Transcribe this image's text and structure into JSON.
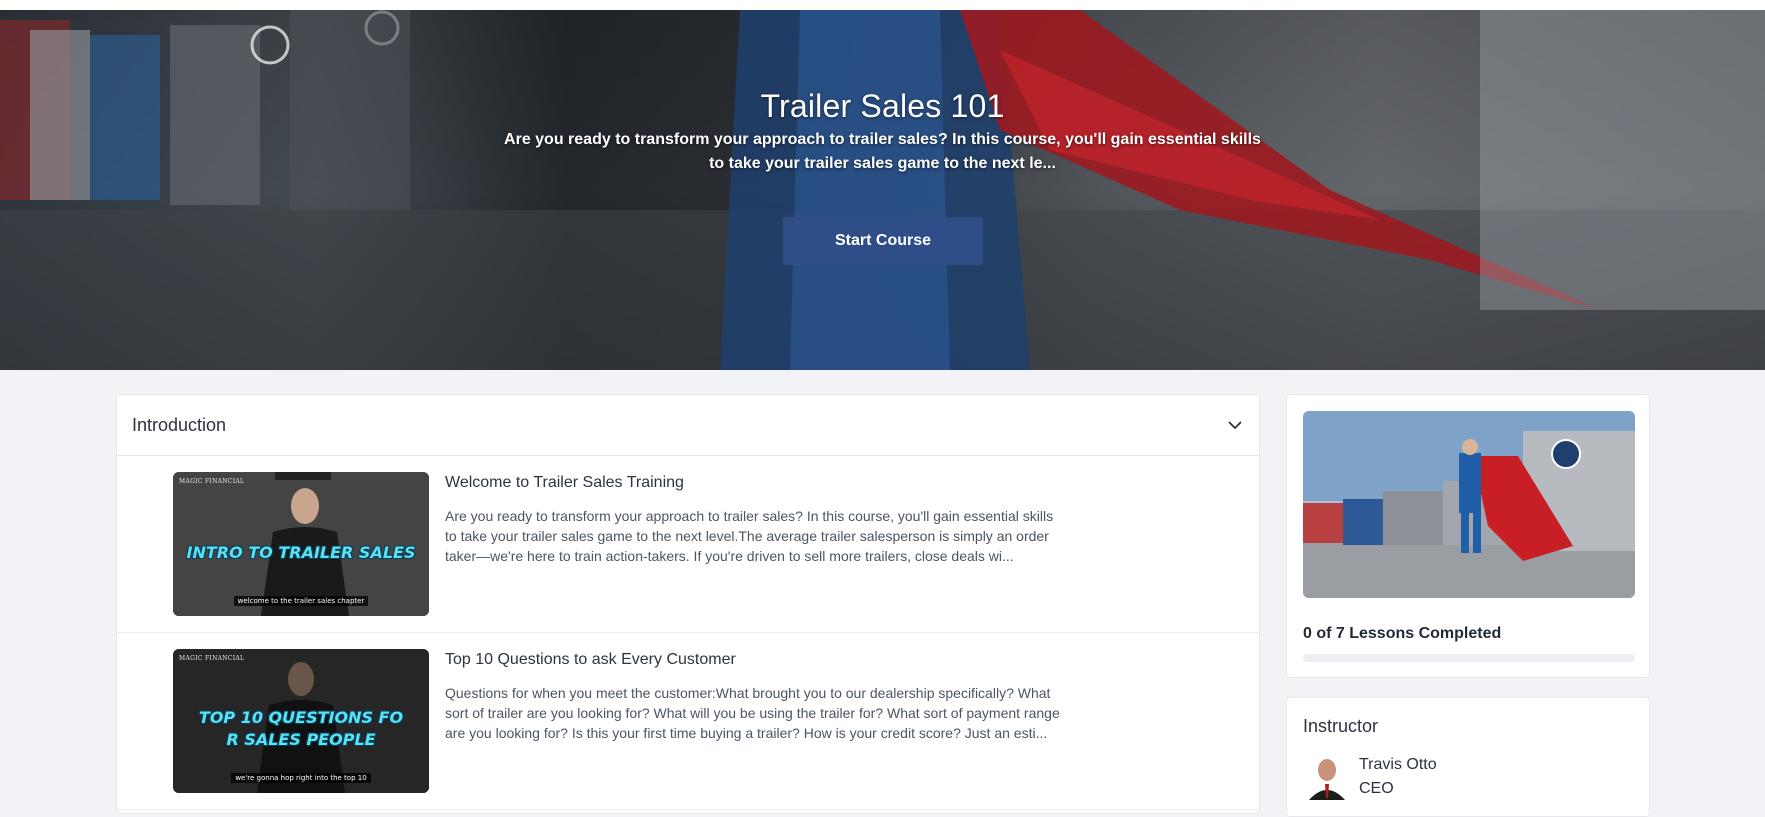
{
  "hero": {
    "title": "Trailer Sales 101",
    "subtitle": "Are you ready to transform your approach to trailer sales? In this course, you'll gain essential skills to take your trailer sales game to the next le...",
    "start_button": "Start Course"
  },
  "section": {
    "title": "Introduction",
    "lessons": [
      {
        "title": "Welcome to Trailer Sales Training",
        "description": "Are you ready to transform your approach to trailer sales? In this course, you'll gain essential skills to take your trailer sales game to the next level.The average trailer salesperson is simply an order taker—we're here to train action-takers. If you're driven to sell more trailers, close deals wi...",
        "thumb_brand": "MAGIC FINANCIAL",
        "thumb_title": "INTRO TO TRAILER SALES",
        "thumb_caption": "welcome to the trailer sales chapter"
      },
      {
        "title": "Top 10 Questions to ask Every Customer",
        "description": "Questions for when you meet the customer:What brought you to our dealership specifically? What sort of trailer are you looking for? What will you be using the trailer for? What sort of payment range are you looking for? Is this your first time buying a trailer? How is your credit score? Just an esti...",
        "thumb_brand": "MAGIC FINANCIAL",
        "thumb_title_line1": "TOP 10 QUESTIONS FO",
        "thumb_title_line2": "R SALES PEOPLE",
        "thumb_caption": "we're gonna hop right into the top 10"
      }
    ]
  },
  "progress": {
    "label": "0 of 7 Lessons Completed",
    "completed": 0,
    "total": 7
  },
  "instructor": {
    "heading": "Instructor",
    "name": "Travis Otto",
    "role": "CEO"
  },
  "colors": {
    "accent": "#2f4d86",
    "hero_cape": "#c81e25",
    "hero_suit": "#1f5fa8"
  }
}
